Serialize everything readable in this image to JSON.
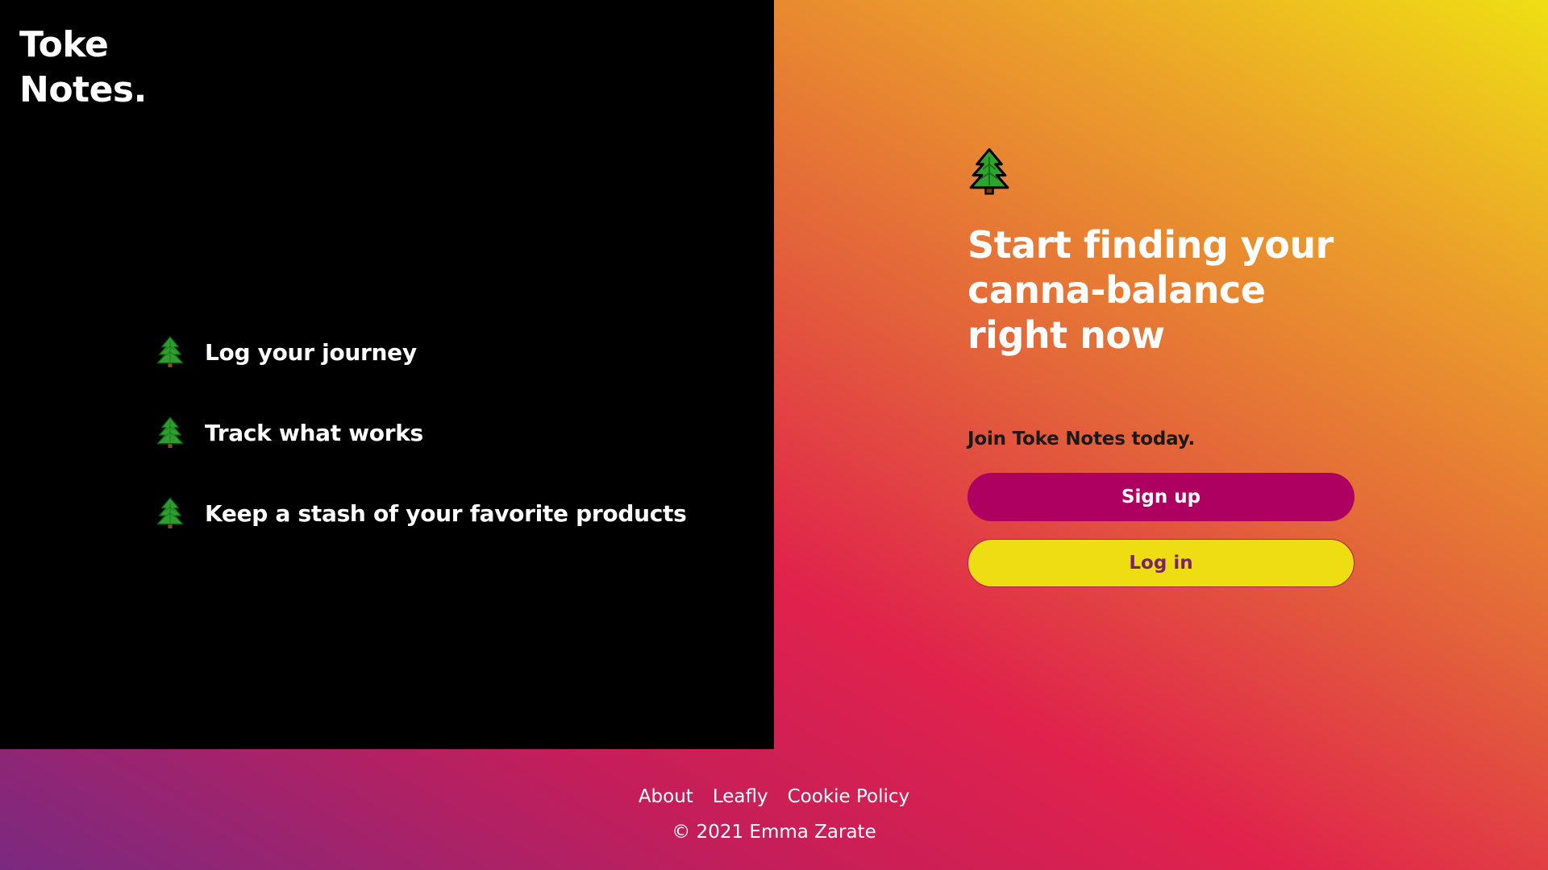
{
  "brand": {
    "line1": "Toke",
    "line2": "Notes."
  },
  "features": [
    {
      "icon": "evergreen-tree-icon",
      "label": "Log your journey"
    },
    {
      "icon": "evergreen-tree-icon",
      "label": "Track what works"
    },
    {
      "icon": "evergreen-tree-icon",
      "label": "Keep a stash of your favorite products"
    }
  ],
  "hero": {
    "icon": "evergreen-tree-icon",
    "headline": "Start finding your canna-balance right now",
    "subheading": "Join Toke Notes today.",
    "signup_label": "Sign up",
    "login_label": "Log in"
  },
  "footer": {
    "links": [
      "About",
      "Leafly",
      "Cookie Policy"
    ],
    "copyright": "© 2021 Emma Zarate"
  },
  "colors": {
    "left_panel": "#000000",
    "signup_button": "#ad0060",
    "login_button": "#efdd14",
    "login_text": "#7a2465",
    "gradient": [
      "#7a2980",
      "#e0224c",
      "#eba02a",
      "#efdf14"
    ]
  }
}
